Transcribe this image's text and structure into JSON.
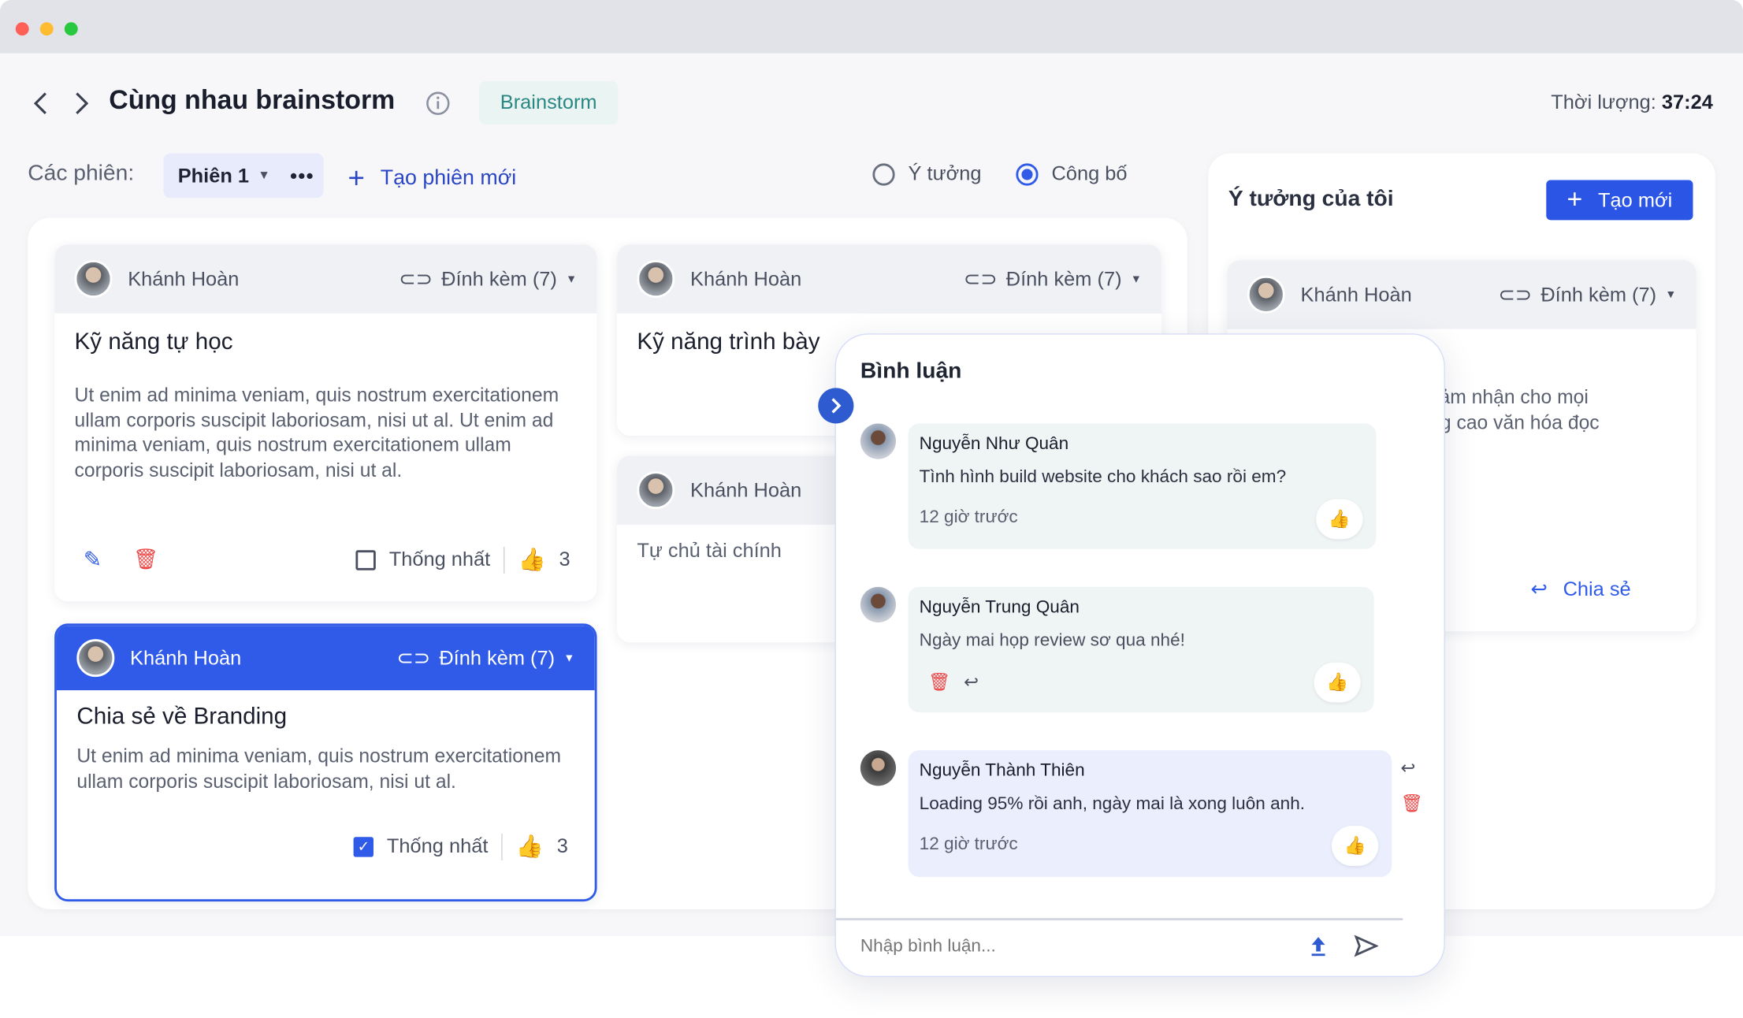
{
  "header": {
    "title": "Cùng nhau brainstorm",
    "badge": "Brainstorm",
    "duration_label": "Thời lượng:",
    "duration_value": "37:24"
  },
  "sessions": {
    "label": "Các phiên:",
    "current": "Phiên 1",
    "new_session": "Tạo phiên mới"
  },
  "view": {
    "options": [
      "Ý tưởng",
      "Công bố"
    ],
    "selected": "Công bố"
  },
  "colors": {
    "accent": "#2f5be8",
    "badge_text": "#2a8783",
    "danger": "#ef4444"
  },
  "cards": [
    {
      "author": "Khánh Hoàn",
      "attach": "Đính kèm (7)",
      "title": "Kỹ năng tự học",
      "body": "Ut enim ad minima veniam, quis nostrum exercitationem ullam corporis suscipit laboriosam, nisi ut al. Ut enim ad minima veniam, quis nostrum exercitationem ullam corporis suscipit laboriosam, nisi ut al.",
      "agree": "Thống nhất",
      "agreed": false,
      "likes": "3"
    },
    {
      "author": "Khánh Hoàn",
      "attach": "Đính kèm (7)",
      "title": "Chia sẻ về Branding",
      "body": "Ut enim ad minima veniam, quis nostrum exercitationem ullam corporis suscipit laboriosam, nisi ut al.",
      "agree": "Thống nhất",
      "agreed": true,
      "likes": "3"
    },
    {
      "author": "Khánh Hoàn",
      "attach": "Đính kèm (7)",
      "title": "Kỹ năng trình bày"
    },
    {
      "author": "Khánh Hoàn",
      "title": "Tự chủ tài chính"
    }
  ],
  "my_ideas": {
    "title": "Ý tưởng của tôi",
    "create": "Tạo mới",
    "card": {
      "author": "Khánh Hoàn",
      "attach": "Đính kèm (7)",
      "line1": "cảm nhận cho mọi",
      "line2": "ng cao văn hóa đọc",
      "share": "Chia sẻ"
    }
  },
  "comments": {
    "title": "Bình luận",
    "placeholder": "Nhập bình luận...",
    "items": [
      {
        "name": "Nguyễn Như Quân",
        "text": "Tình hình build website cho khách sao rồi em?",
        "time": "12 giờ trước"
      },
      {
        "name": "Nguyễn Trung Quân",
        "text": "Ngày mai họp review sơ qua nhé!"
      },
      {
        "name": "Nguyễn Thành Thiên",
        "text": "Loading 95% rồi anh, ngày mai là xong luôn anh.",
        "time": "12 giờ trước"
      }
    ]
  }
}
